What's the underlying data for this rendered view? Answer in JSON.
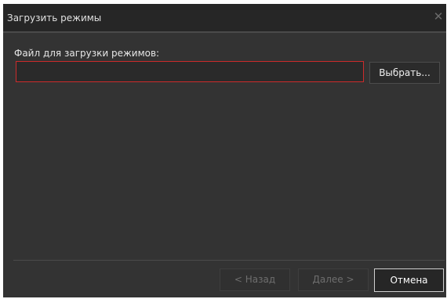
{
  "dialog": {
    "title": "Загрузить режимы",
    "close_icon": "close-icon"
  },
  "file_field": {
    "label": "Файл для загрузки режимов:",
    "value": "",
    "placeholder": "",
    "border_color": "#cc2b2b"
  },
  "browse_button": {
    "label": "Выбрать..."
  },
  "footer": {
    "back_label": "< Назад",
    "next_label": "Далее >",
    "cancel_label": "Отмена"
  },
  "colors": {
    "window_bg": "#333333",
    "titlebar_bg": "#262626",
    "error_border": "#cc2b2b",
    "disabled_text": "#6e6e6e"
  }
}
